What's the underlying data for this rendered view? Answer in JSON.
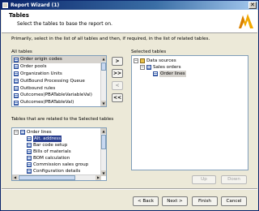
{
  "window": {
    "title": "Report Wizard (1)",
    "close_glyph": "✕"
  },
  "header": {
    "title": "Tables",
    "subtitle": "Select the tables to base the report on."
  },
  "instruction": "Primarily, select in the list of all tables and then, if required, in the list of related tables.",
  "all_tables": {
    "label": "All tables",
    "items": [
      "Order origin codes",
      "Order pools",
      "Organization Units",
      "OutBound Processing Queue",
      "Outbound rules",
      "Outcomes(PBATableVariableVal)",
      "Outcomes(PBATableVal)"
    ]
  },
  "move_buttons": {
    "add": ">",
    "add_all": ">>",
    "remove": "<",
    "remove_all": "<<"
  },
  "selected_tables": {
    "label": "Selected tables",
    "root": "Data sources",
    "child": "Sales orders",
    "grandchild": "Order lines"
  },
  "related": {
    "label": "Tables that are related to the Selected tables",
    "root": "Order lines",
    "items": [
      "Alt. address",
      "Bar code setup",
      "Bills of materials",
      "BOM calculation",
      "Commission sales group",
      "Configuration details"
    ]
  },
  "order_buttons": {
    "up": "Up",
    "down": "Down"
  },
  "footer": {
    "back": "< Back",
    "next": "Next >",
    "finish": "Finish",
    "cancel": "Cancel"
  },
  "icons": {
    "expand_minus": "−",
    "arrow_up": "▲",
    "arrow_down": "▼",
    "arrow_left": "◀",
    "arrow_right": "▶"
  },
  "colors": {
    "selection": "#2a3f8f",
    "titlebar": "#0a246a",
    "dialog_bg": "#ece9d8"
  }
}
